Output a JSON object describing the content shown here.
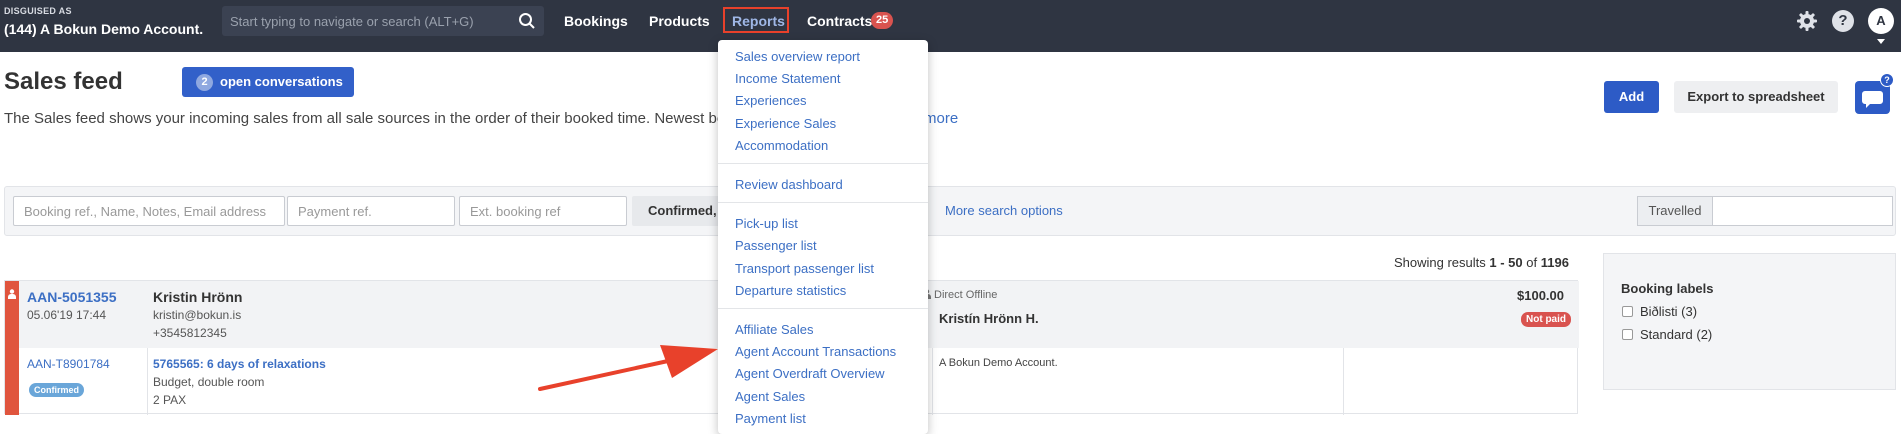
{
  "header": {
    "disguised_label": "DISGUISED AS",
    "account_name": "(144) A Bokun Demo Account.",
    "search_placeholder": "Start typing to navigate or search (ALT+G)",
    "nav": {
      "bookings": "Bookings",
      "products": "Products",
      "reports": "Reports",
      "contracts": "Contracts",
      "contracts_count": "25"
    },
    "help_label": "?",
    "avatar_initial": "A"
  },
  "page": {
    "title": "Sales feed",
    "open_conversations_count": "2",
    "open_conversations_label": "open conversations",
    "description": "The Sales feed shows your incoming sales from all sale sources in the order of their booked time. Newest bo",
    "description_more": "more",
    "add_label": "Add",
    "export_label": "Export to spreadsheet",
    "chat_badge": "?"
  },
  "filters": {
    "booking_ref_placeholder": "Booking ref., Name, Notes, Email address",
    "payment_ref_placeholder": "Payment ref.",
    "ext_ref_placeholder": "Ext. booking ref",
    "status_label": "Confirmed,",
    "more_search": "More search options",
    "travelled_label": "Travelled"
  },
  "results": {
    "prefix": "Showing results ",
    "range": "1 - 50",
    "of": " of ",
    "total": "1196"
  },
  "booking": {
    "ref": "AAN-5051355",
    "date": "05.06'19 17:44",
    "customer_name": "Kristin Hrönn",
    "customer_email": "kristin@bokun.is",
    "customer_phone": "+3545812345",
    "product_ref": "AAN-T8901784",
    "status": "Confirmed",
    "product_title": "5765565: 6 days of relaxations",
    "product_rate": "Budget, double room",
    "pax": "2 PAX",
    "source": "Direct Offline",
    "booker": "Kristín Hrönn H.",
    "seller": "A Bokun Demo Account.",
    "amount": "$100.00",
    "payment_status": "Not paid"
  },
  "labels_panel": {
    "title": "Booking labels",
    "items": [
      {
        "label": "Biðlisti (3)"
      },
      {
        "label": "Standard (2)"
      }
    ]
  },
  "reports_menu": {
    "groups": [
      [
        "Sales overview report",
        "Income Statement",
        "Experiences",
        "Experience Sales",
        "Accommodation"
      ],
      [
        "Review dashboard"
      ],
      [
        "Pick-up list",
        "Passenger list",
        "Transport passenger list",
        "Departure statistics"
      ],
      [
        "Affiliate Sales",
        "Agent Account Transactions",
        "Agent Overdraft Overview",
        "Agent Sales",
        "Payment list"
      ]
    ]
  },
  "colors": {
    "navbar": "#2f3542",
    "accent_blue": "#2d5bc6",
    "link": "#3c6fc4",
    "highlight_red": "#e8412b"
  }
}
